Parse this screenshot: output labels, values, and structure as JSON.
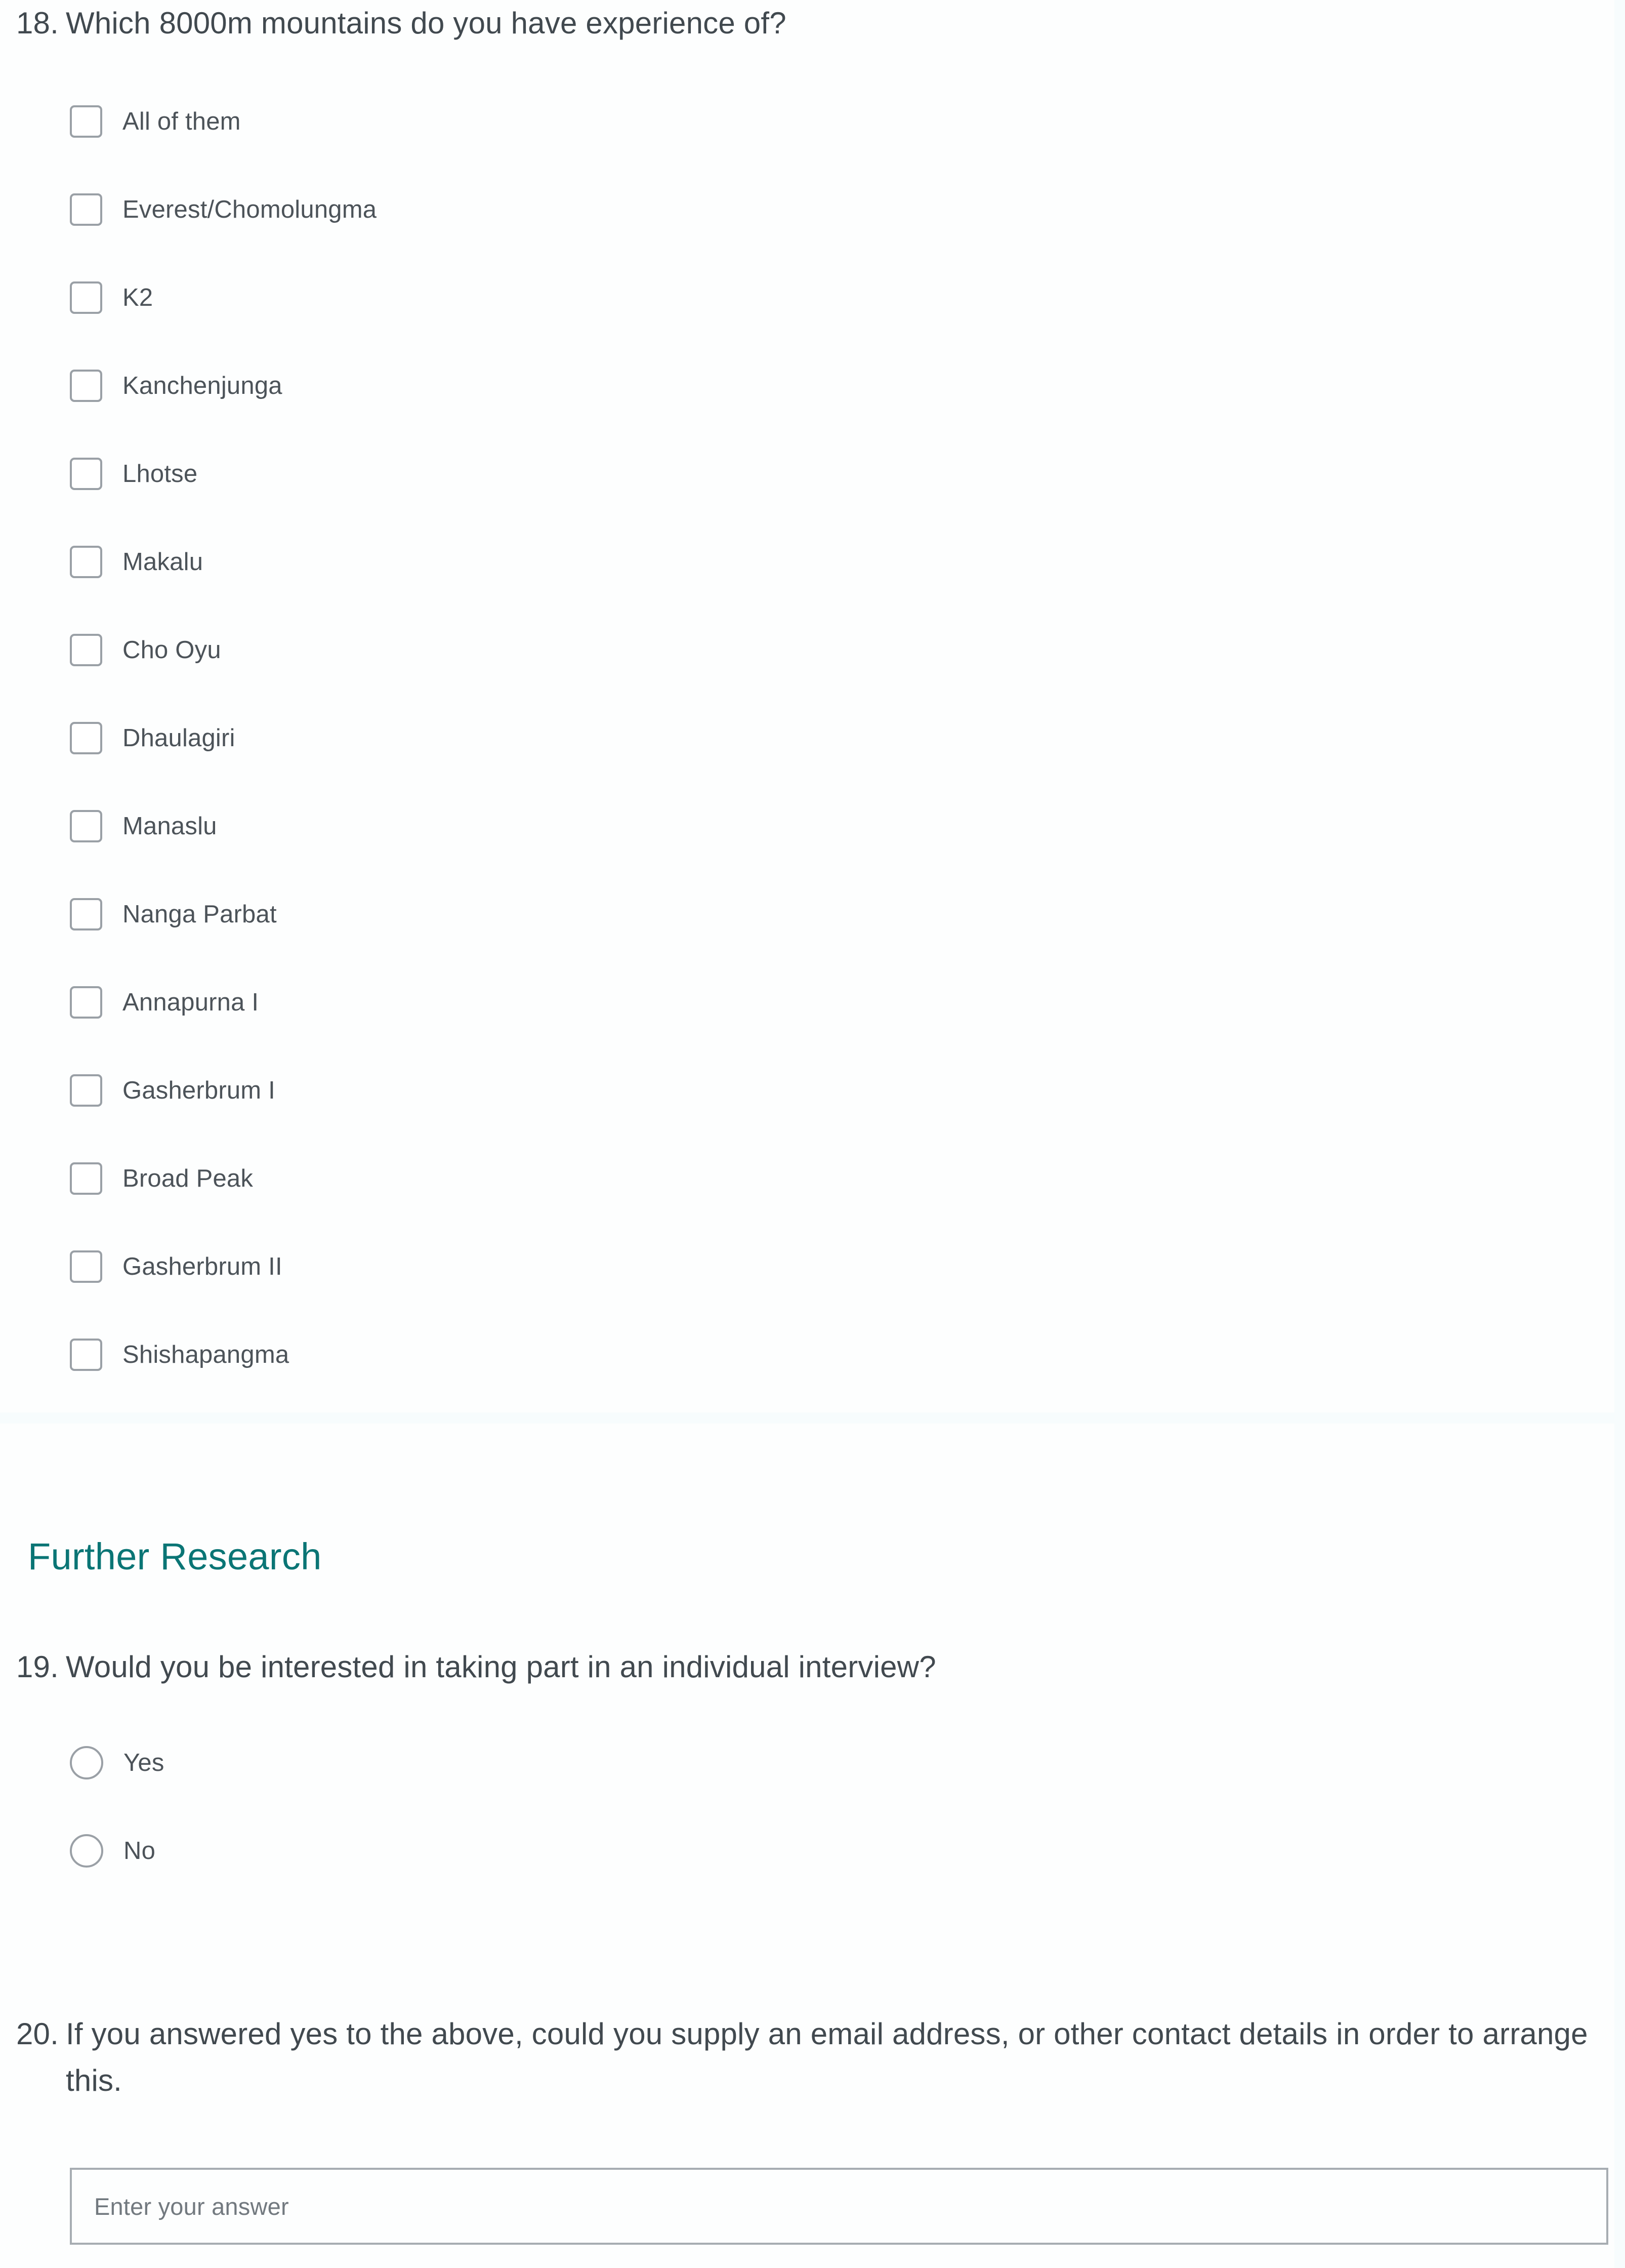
{
  "colors": {
    "page_background": "#f7fcfd",
    "card_background": "#fdfefe",
    "question_text": "#41494f",
    "option_text": "#4c5359",
    "section_title_teal": "#0a7575",
    "control_border": "#9aa0a6",
    "input_border": "#a7adb2",
    "placeholder_text": "#72797f"
  },
  "questions": [
    {
      "number": "18.",
      "text": "Which 8000m mountains do you have experience of?",
      "control": "checkbox",
      "options": [
        "All of them",
        "Everest/Chomolungma",
        "K2",
        "Kanchenjunga",
        "Lhotse",
        "Makalu",
        "Cho Oyu",
        "Dhaulagiri",
        "Manaslu",
        "Nanga Parbat",
        "Annapurna I",
        "Gasherbrum I",
        "Broad Peak",
        "Gasherbrum II",
        "Shishapangma"
      ]
    },
    {
      "number": "19.",
      "text": "Would you be interested in taking part in an individual interview?",
      "control": "radio",
      "options": [
        "Yes",
        "No"
      ]
    },
    {
      "number": "20.",
      "text": "If you answered yes to the above, could you supply an email address, or other contact details in order to arrange this.",
      "control": "text",
      "placeholder": "Enter your answer",
      "value": ""
    }
  ],
  "sections": {
    "further_research_title": "Further Research"
  }
}
